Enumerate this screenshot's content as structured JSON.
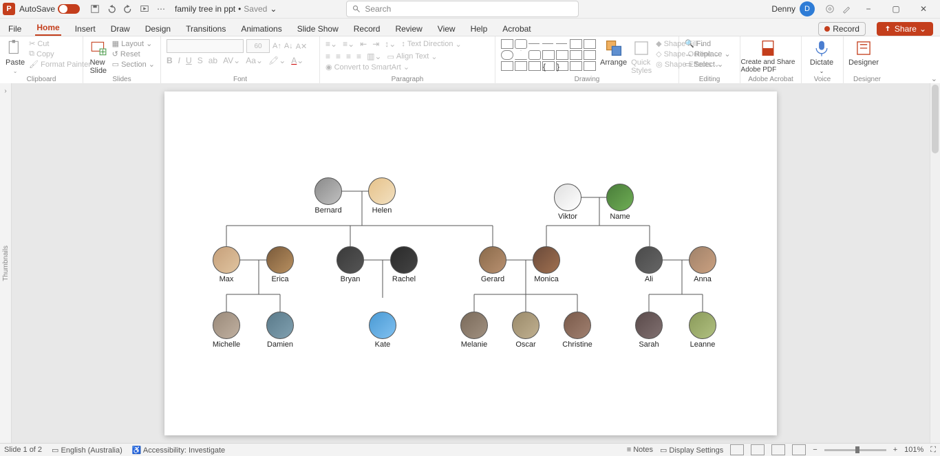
{
  "titlebar": {
    "autosave": "AutoSave",
    "autosave_state": "On",
    "doc_name": "family tree in ppt",
    "doc_saved": "Saved",
    "search_placeholder": "Search",
    "user_name": "Denny",
    "user_initial": "D"
  },
  "tabs": {
    "file": "File",
    "home": "Home",
    "insert": "Insert",
    "draw": "Draw",
    "design": "Design",
    "transitions": "Transitions",
    "animations": "Animations",
    "slideshow": "Slide Show",
    "record": "Record",
    "review": "Review",
    "view": "View",
    "help": "Help",
    "acrobat": "Acrobat",
    "record_btn": "Record",
    "share": "Share"
  },
  "ribbon": {
    "clipboard": {
      "label": "Clipboard",
      "paste": "Paste",
      "cut": "Cut",
      "copy": "Copy",
      "format_painter": "Format Painter"
    },
    "slides": {
      "label": "Slides",
      "new_slide": "New\nSlide",
      "layout": "Layout",
      "reset": "Reset",
      "section": "Section"
    },
    "font": {
      "label": "Font",
      "size": "60"
    },
    "paragraph": {
      "label": "Paragraph",
      "text_direction": "Text Direction",
      "align_text": "Align Text",
      "convert": "Convert to SmartArt"
    },
    "drawing": {
      "label": "Drawing",
      "arrange": "Arrange",
      "quick_styles": "Quick\nStyles",
      "shape_fill": "Shape Fill",
      "shape_outline": "Shape Outline",
      "shape_effects": "Shape Effects"
    },
    "editing": {
      "label": "Editing",
      "find": "Find",
      "replace": "Replace",
      "select": "Select"
    },
    "adobe": {
      "label": "Adobe Acrobat",
      "create": "Create and Share\nAdobe PDF"
    },
    "voice": {
      "label": "Voice",
      "dictate": "Dictate"
    },
    "designer": {
      "label": "Designer",
      "designer": "Designer"
    }
  },
  "thumbnails_label": "Thumbnails",
  "family": {
    "bernard": "Bernard",
    "helen": "Helen",
    "viktor": "Viktor",
    "name": "Name",
    "max": "Max",
    "erica": "Erica",
    "bryan": "Bryan",
    "rachel": "Rachel",
    "gerard": "Gerard",
    "monica": "Monica",
    "ali": "Ali",
    "anna": "Anna",
    "michelle": "Michelle",
    "damien": "Damien",
    "kate": "Kate",
    "melanie": "Melanie",
    "oscar": "Oscar",
    "christine": "Christine",
    "sarah": "Sarah",
    "leanne": "Leanne"
  },
  "statusbar": {
    "slide": "Slide 1 of 2",
    "language": "English (Australia)",
    "accessibility": "Accessibility: Investigate",
    "notes": "Notes",
    "display": "Display Settings",
    "zoom": "101%"
  }
}
